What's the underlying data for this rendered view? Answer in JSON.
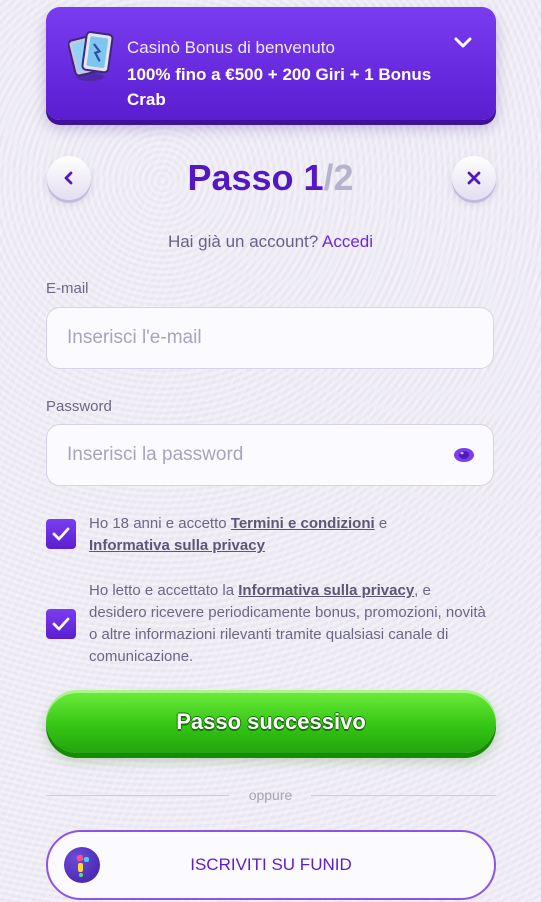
{
  "bonus": {
    "subtitle": "Casinò Bonus di benvenuto",
    "title": "100% fino a €500 + 200 Giri + 1 Bonus Crab",
    "icon": "cards-icon",
    "color_start": "#7a3cf0",
    "color_end": "#5a1dd0"
  },
  "header": {
    "step_label": "Passo 1",
    "step_total": "/2",
    "back_icon": "chevron-left-icon",
    "close_icon": "close-icon"
  },
  "login": {
    "prompt": "Hai già un account?",
    "link": "Accedi"
  },
  "email": {
    "label": "E-mail",
    "placeholder": "Inserisci l'e-mail",
    "value": ""
  },
  "password": {
    "label": "Password",
    "placeholder": "Inserisci la password",
    "value": "",
    "toggle_icon": "eye-icon"
  },
  "consent1": {
    "checked": true,
    "text_before": "Ho 18 anni e accetto ",
    "terms_link": "Termini e condizioni",
    "text_mid": " e ",
    "privacy_link": "Informativa sulla privacy"
  },
  "consent2": {
    "checked": true,
    "text_before": "Ho letto e accettato la ",
    "privacy_link": "Informativa sulla privacy",
    "text_after": ", e desidero ricevere periodicamente bonus, promozioni, novità o altre informazioni rilevanti tramite qualsiasi canale di comunicazione."
  },
  "next_button": {
    "label": "Passo successivo",
    "color": "#36c616"
  },
  "divider": {
    "label": "oppure"
  },
  "funid": {
    "label": "ISCRIVITI SU FUNID",
    "icon": "funid-logo-icon"
  },
  "colors": {
    "accent": "#5218c2",
    "muted_step": "#b8b3cc",
    "link": "#6a2ad9"
  }
}
